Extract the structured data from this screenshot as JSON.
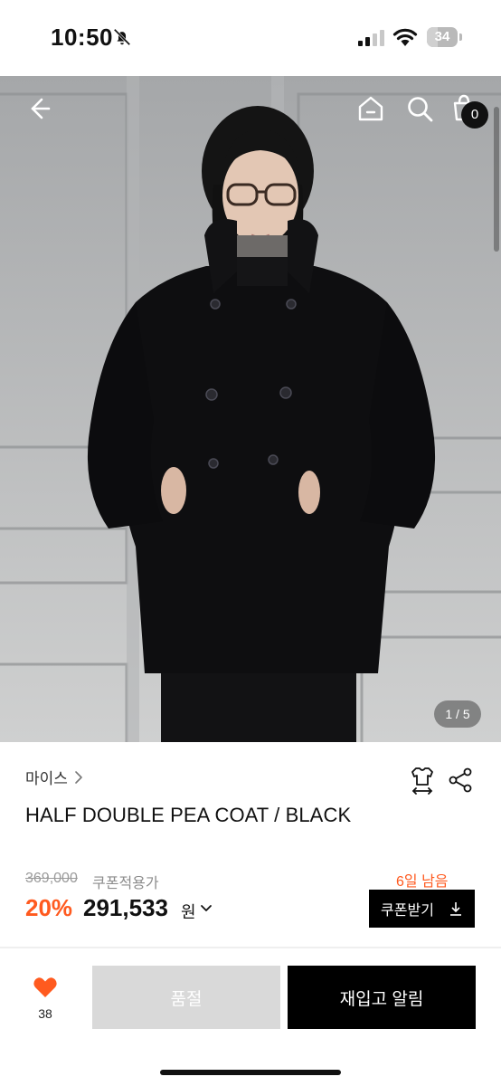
{
  "status_bar": {
    "time": "10:50",
    "battery_level": "34",
    "battery_fraction": 0.34
  },
  "hero": {
    "image_counter": "1 / 5",
    "cart_count": "0",
    "icons": [
      "back-arrow-icon",
      "home-icon",
      "search-icon",
      "cart-icon"
    ]
  },
  "product": {
    "brand": "마이스",
    "title": "HALF DOUBLE PEA COAT / BLACK",
    "original_price": "369,000",
    "coupon_applied_label": "쿠폰적용가",
    "discount_rate": "20%",
    "sale_price": "291,533",
    "currency": "원",
    "days_left": "6일 남음",
    "coupon_button_label": "쿠폰받기"
  },
  "bottom_bar": {
    "like_count": "38",
    "soldout_label": "품절",
    "restock_label": "재입고 알림"
  },
  "colors": {
    "accent": "#ff5a1f",
    "heart": "#ff5a1f",
    "button_dark": "#000000",
    "button_disabled": "#d9d9d9"
  }
}
